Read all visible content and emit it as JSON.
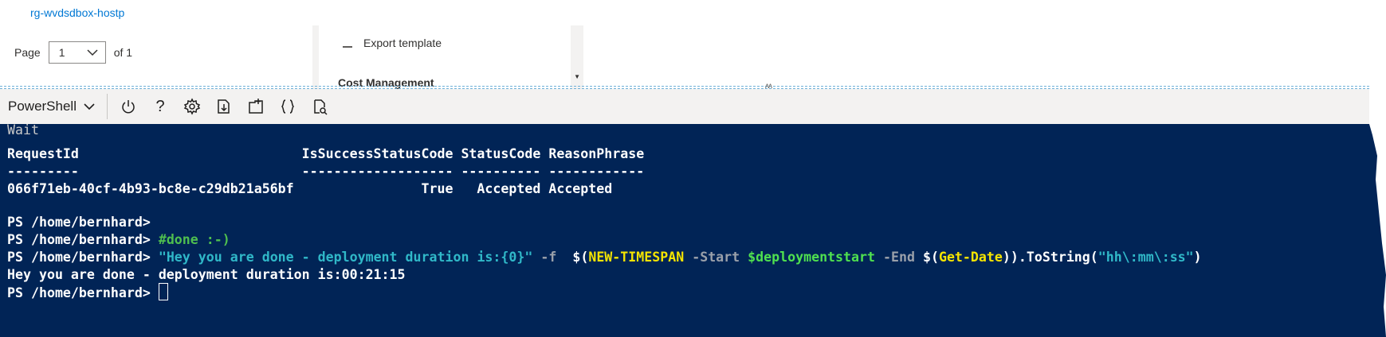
{
  "portal": {
    "resource_group_link": "rg-wvdsdbox-hostp",
    "pager": {
      "label": "Page",
      "current": "1",
      "of_label": "of 1"
    },
    "menu": {
      "export_template": "Export template",
      "cost_management": "Cost Management"
    }
  },
  "toolbar": {
    "shell_type": "PowerShell",
    "icons": [
      "power-icon",
      "help-icon",
      "settings-icon",
      "upload-download-icon",
      "open-editor-icon",
      "braces-icon",
      "web-preview-icon"
    ]
  },
  "terminal": {
    "wait": "Wait",
    "header": "RequestId                            IsSuccessStatusCode StatusCode ReasonPhrase",
    "dashes": "---------                            ------------------- ---------- ------------",
    "row": "066f71eb-40cf-4b93-bc8e-c29db21a56bf                True   Accepted Accepted",
    "prompt": "PS /home/bernhard> ",
    "comment": "#done :-)",
    "cmd_string": "\"Hey you are done - deployment duration is:{0}\"",
    "cmd_f": " -f ",
    "cmd_dollar1": " $(",
    "cmd_newts": "NEW-TIMESPAN",
    "cmd_start": " -Start ",
    "cmd_var": "$deploymentstart",
    "cmd_end": " -End ",
    "cmd_dollar2": "$(",
    "cmd_getdate": "Get-Date",
    "cmd_tostring": ")).ToString(",
    "cmd_format": "\"hh\\:mm\\:ss\"",
    "cmd_close": ")",
    "output": "Hey you are done - deployment duration is:00:21:15"
  },
  "colors": {
    "terminal_bg": "#012456",
    "comment": "#4fbf4f",
    "string": "#30b8c8",
    "cmdlet": "#f5e400",
    "variable": "#4fe04f",
    "link": "#0078d4"
  }
}
